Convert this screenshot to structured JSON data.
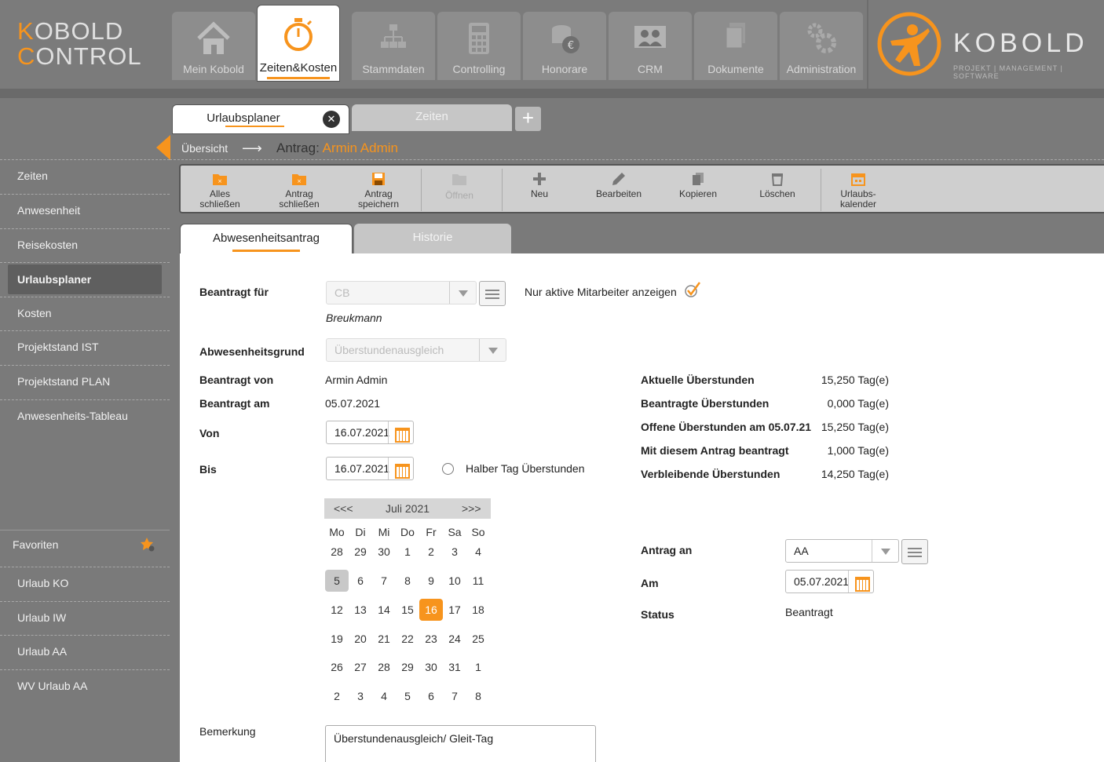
{
  "logo": {
    "line1": "KOBOLD",
    "line2": "CONTROL"
  },
  "brand": {
    "name": "KOBOLD",
    "tagline": "PROJEKT | MANAGEMENT | SOFTWARE"
  },
  "nav": [
    {
      "label": "Mein Kobold",
      "icon": "house-icon"
    },
    {
      "label": "Zeiten&Kosten",
      "icon": "stopwatch-icon"
    },
    {
      "label": "Stammdaten",
      "icon": "hierarchy-icon"
    },
    {
      "label": "Controlling",
      "icon": "calculator-icon"
    },
    {
      "label": "Honorare",
      "icon": "coins-icon"
    },
    {
      "label": "CRM",
      "icon": "people-icon"
    },
    {
      "label": "Dokumente",
      "icon": "documents-icon"
    },
    {
      "label": "Administration",
      "icon": "gears-icon"
    }
  ],
  "doc_tabs": {
    "active": "Urlaubsplaner",
    "other": "Zeiten"
  },
  "breadcrumb": {
    "root": "Übersicht",
    "current_prefix": "Antrag:",
    "current_user": "Armin Admin"
  },
  "toolbar": [
    {
      "label1": "Alles",
      "label2": "schließen"
    },
    {
      "label1": "Antrag",
      "label2": "schließen"
    },
    {
      "label1": "Antrag",
      "label2": "speichern"
    },
    {
      "label1": "Öffnen",
      "label2": ""
    },
    {
      "label1": "Neu",
      "label2": ""
    },
    {
      "label1": "Bearbeiten",
      "label2": ""
    },
    {
      "label1": "Kopieren",
      "label2": ""
    },
    {
      "label1": "Löschen",
      "label2": ""
    },
    {
      "label1": "Urlaubs-",
      "label2": "kalender"
    }
  ],
  "sidebar": {
    "items": [
      "Zeiten",
      "Anwesenheit",
      "Reisekosten",
      "Urlaubsplaner",
      "Kosten",
      "Projektstand IST",
      "Projektstand PLAN",
      "Anwesenheits-Tableau"
    ],
    "favorites_label": "Favoriten",
    "favorites": [
      "Urlaub KO",
      "Urlaub IW",
      "Urlaub AA",
      "WV Urlaub AA"
    ]
  },
  "form_tabs": {
    "active": "Abwesenheitsantrag",
    "other": "Historie"
  },
  "form": {
    "beantragt_fuer_label": "Beantragt für",
    "beantragt_fuer_value": "CB",
    "beantragt_fuer_name": "Breukmann",
    "nur_aktive_label": "Nur aktive Mitarbeiter anzeigen",
    "grund_label": "Abwesenheitsgrund",
    "grund_value": "Überstundenausgleich",
    "von_label_person": "Beantragt von",
    "von_value_person": "Armin Admin",
    "am_label": "Beantragt am",
    "am_value": "05.07.2021",
    "von_label": "Von",
    "von_date": "16.07.2021",
    "bis_label": "Bis",
    "bis_date": "16.07.2021",
    "halber_tag_label": "Halber Tag Überstunden",
    "bemerkung_label": "Bemerkung",
    "bemerkung_value": "Überstundenausgleich/ Gleit-Tag"
  },
  "stats": [
    {
      "label": "Aktuelle Überstunden",
      "value": "15,250 Tag(e)"
    },
    {
      "label": "Beantragte Überstunden",
      "value": "0,000 Tag(e)"
    },
    {
      "label": "Offene Überstunden am 05.07.21",
      "value": "15,250 Tag(e)"
    },
    {
      "label": "Mit diesem Antrag beantragt",
      "value": "1,000 Tag(e)"
    },
    {
      "label": "Verbleibende Überstunden",
      "value": "14,250 Tag(e)"
    }
  ],
  "approval": {
    "antrag_an_label": "Antrag an",
    "antrag_an_value": "AA",
    "am_label": "Am",
    "am_value": "05.07.2021",
    "status_label": "Status",
    "status_value": "Beantragt"
  },
  "calendar": {
    "prev": "<<<",
    "next": ">>>",
    "month": "Juli 2021",
    "weekdays": [
      "Mo",
      "Di",
      "Mi",
      "Do",
      "Fr",
      "Sa",
      "So"
    ],
    "weeks": [
      [
        "28",
        "29",
        "30",
        "1",
        "2",
        "3",
        "4"
      ],
      [
        "5",
        "6",
        "7",
        "8",
        "9",
        "10",
        "11"
      ],
      [
        "12",
        "13",
        "14",
        "15",
        "16",
        "17",
        "18"
      ],
      [
        "19",
        "20",
        "21",
        "22",
        "23",
        "24",
        "25"
      ],
      [
        "26",
        "27",
        "28",
        "29",
        "30",
        "31",
        "1"
      ],
      [
        "2",
        "3",
        "4",
        "5",
        "6",
        "7",
        "8"
      ]
    ],
    "today": "5",
    "selected": "16"
  },
  "colors": {
    "accent": "#f7941d",
    "chrome": "#7a7a7a",
    "toolbar": "#cfcfcf"
  }
}
